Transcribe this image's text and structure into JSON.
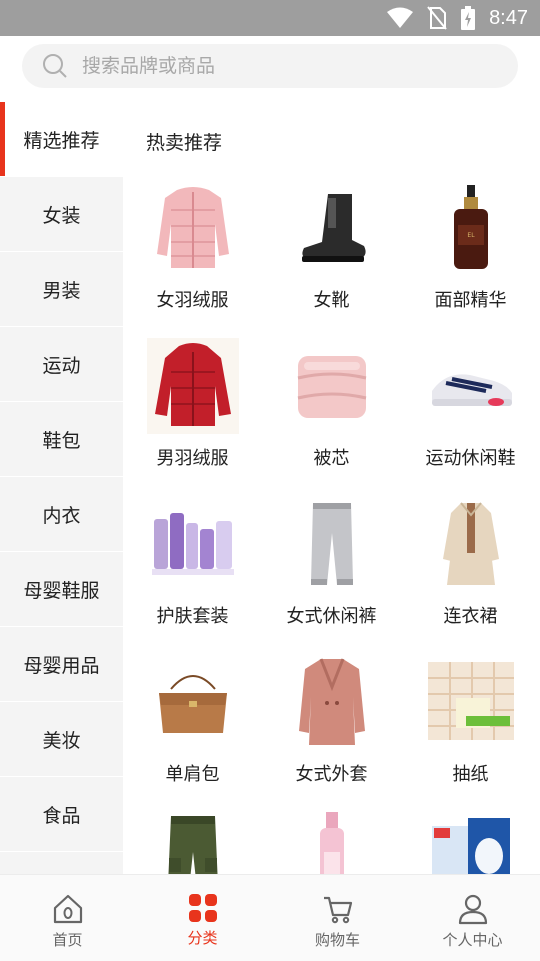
{
  "status_bar": {
    "time": "8:47"
  },
  "search": {
    "placeholder": "搜索品牌或商品"
  },
  "sidebar": {
    "items": [
      {
        "label": "精选推荐",
        "active": true
      },
      {
        "label": "女装"
      },
      {
        "label": "男装"
      },
      {
        "label": "运动"
      },
      {
        "label": "鞋包"
      },
      {
        "label": "内衣"
      },
      {
        "label": "母婴鞋服"
      },
      {
        "label": "母婴用品"
      },
      {
        "label": "美妆"
      },
      {
        "label": "食品"
      }
    ]
  },
  "content": {
    "section_title": "热卖推荐",
    "products": [
      {
        "label": "女羽绒服",
        "icon": "pink-down-jacket-image"
      },
      {
        "label": "女靴",
        "icon": "black-boot-image"
      },
      {
        "label": "面部精华",
        "icon": "serum-bottle-image"
      },
      {
        "label": "男羽绒服",
        "icon": "red-down-jacket-image"
      },
      {
        "label": "被芯",
        "icon": "quilt-image"
      },
      {
        "label": "运动休闲鞋",
        "icon": "sneaker-image"
      },
      {
        "label": "护肤套装",
        "icon": "skincare-set-image"
      },
      {
        "label": "女式休闲裤",
        "icon": "sweatpants-image"
      },
      {
        "label": "连衣裙",
        "icon": "dress-image"
      },
      {
        "label": "单肩包",
        "icon": "shoulder-bag-image"
      },
      {
        "label": "女式外套",
        "icon": "coat-image"
      },
      {
        "label": "抽纸",
        "icon": "tissue-pack-image"
      },
      {
        "label": "",
        "icon": "cargo-pants-image"
      },
      {
        "label": "",
        "icon": "pink-bottle-image"
      },
      {
        "label": "",
        "icon": "face-mask-box-image"
      }
    ]
  },
  "tabbar": {
    "tabs": [
      {
        "label": "首页",
        "icon": "home-icon"
      },
      {
        "label": "分类",
        "icon": "category-icon",
        "active": true
      },
      {
        "label": "购物车",
        "icon": "cart-icon"
      },
      {
        "label": "个人中心",
        "icon": "user-icon"
      }
    ]
  },
  "colors": {
    "accent": "#e8341c",
    "status_bar": "#9e9e9e",
    "sidebar_bg": "#f4f4f4"
  }
}
